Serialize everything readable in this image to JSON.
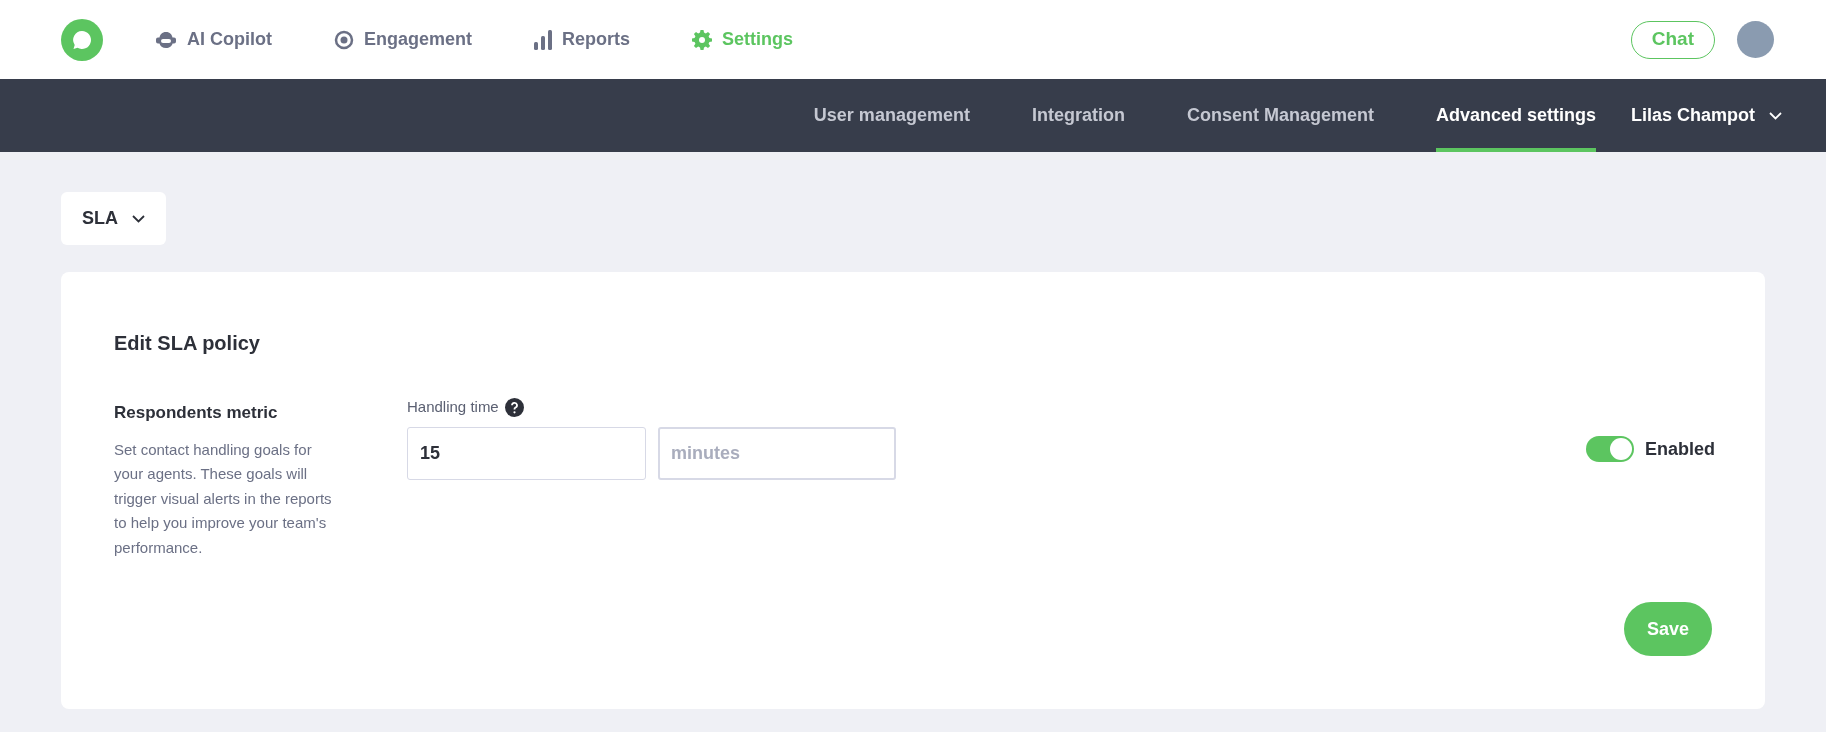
{
  "top_nav": {
    "items": [
      {
        "label": "AI Copilot",
        "kind": "copilot",
        "selected": false
      },
      {
        "label": "Engagement",
        "kind": "engagement",
        "selected": false
      },
      {
        "label": "Reports",
        "kind": "reports",
        "selected": false
      },
      {
        "label": "Settings",
        "kind": "settings",
        "selected": true
      }
    ],
    "chat_button": "Chat"
  },
  "sub_nav": {
    "tabs": [
      {
        "label": "User management",
        "selected": false
      },
      {
        "label": "Integration",
        "selected": false
      },
      {
        "label": "Consent Management",
        "selected": false
      },
      {
        "label": "Advanced settings",
        "selected": true
      }
    ],
    "account": "Lilas Champot"
  },
  "section_dropdown": "SLA",
  "card": {
    "title": "Edit SLA policy",
    "metric_title": "Respondents metric",
    "metric_description": "Set contact handling goals for your agents. These goals will trigger visual alerts in the reports to help you improve your team's performance.",
    "field_label": "Handling time",
    "value": "15",
    "unit_placeholder": "minutes",
    "toggle": {
      "label": "Enabled",
      "on": true
    },
    "save_button": "Save"
  }
}
